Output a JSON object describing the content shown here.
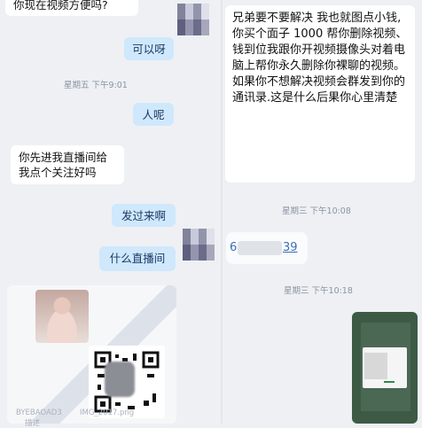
{
  "messages": {
    "m1": "你现在视频方便吗?",
    "m2": "可以呀",
    "t1": "星期五 下午9:01",
    "m3": "人呢",
    "m4": "你先进我直播间给我点个关注好吗",
    "m5": "发过来啊",
    "m6": "什么直播间",
    "r1": "兄弟要不要解决 我也就图点小钱, 你买个面子 1000 帮你删除视频、钱到位我跟你开视频摄像头对着电脑上帮你永久删除你裸聊的视频。\n如果你不想解决视频会群发到你的通讯录.这是什么后果你心里清楚",
    "t2": "星期三 下午10:08",
    "phone_start": "6",
    "phone_end": "39",
    "t3": "星期三 下午10:18"
  },
  "watermark": {
    "line1": "BYEBAOAD3",
    "line2": "IMG_2017.png",
    "line3": "描述"
  },
  "colors": {
    "incoming": "#ffffff",
    "outgoing": "#cfe8fb",
    "background": "#eef0f4"
  }
}
